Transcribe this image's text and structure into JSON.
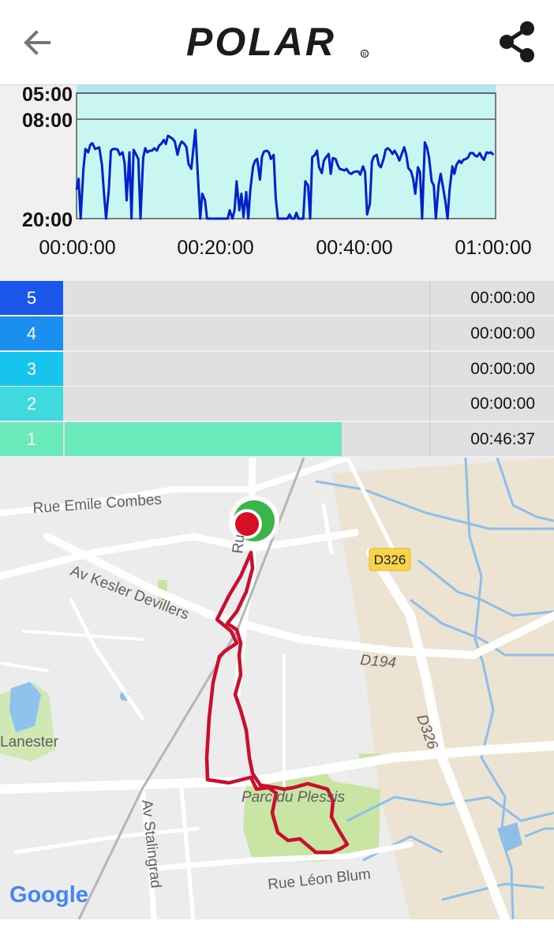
{
  "header": {
    "brand": "POLAR",
    "back_icon": "arrow-left-icon",
    "share_icon": "share-icon"
  },
  "chart_data": {
    "type": "line",
    "xlabel": "",
    "ylabel": "",
    "y_axis_inverted": true,
    "y_tick_labels": [
      "05:00",
      "08:00",
      "20:00"
    ],
    "x_tick_labels": [
      "00:00:00",
      "00:20:00",
      "00:40:00",
      "01:00:00"
    ],
    "x_range_min": [
      0,
      61
    ],
    "y_range_min_per_km": [
      4.5,
      20
    ],
    "line_color": "#0022cc",
    "band_color": "#c9f6f0",
    "series": [
      {
        "x_min": [
          0.0,
          0.3,
          0.6,
          1.0,
          1.3,
          1.7,
          2.0,
          2.3,
          2.7,
          3.0,
          3.3,
          3.7,
          4.0,
          4.3,
          4.7,
          5.0,
          5.3,
          5.7,
          6.0,
          6.3,
          6.7,
          7.0,
          7.3,
          7.7,
          8.0,
          8.3,
          8.7,
          9.0,
          9.3,
          9.7,
          10.0,
          10.3,
          10.7,
          11.0,
          11.3,
          11.7,
          12.0,
          12.3,
          12.7,
          13.0,
          13.3,
          13.7,
          14.0,
          14.3,
          14.7,
          15.0,
          15.3,
          15.7,
          16.0,
          16.3,
          16.7,
          17.0,
          17.3,
          17.7,
          18.0,
          18.3,
          18.7,
          19.0,
          19.3,
          19.7,
          20.0,
          20.3,
          20.7,
          21.0,
          21.3,
          21.7,
          22.0,
          22.3,
          22.7,
          23.0,
          23.3,
          23.7,
          24.0,
          24.3,
          24.7,
          25.0,
          25.3,
          25.7,
          26.0,
          26.3,
          26.7,
          27.0,
          27.3,
          27.7,
          28.0,
          28.3,
          28.7,
          29.0,
          29.3,
          29.7,
          30.0,
          30.3,
          30.7,
          31.0,
          31.3,
          31.7,
          32.0,
          32.3,
          32.7,
          33.0,
          33.3,
          33.7,
          34.0,
          34.3,
          34.7,
          35.0,
          35.3,
          35.7,
          36.0,
          36.3,
          36.7,
          37.0,
          37.3,
          37.7,
          38.0,
          38.3,
          38.7,
          39.0,
          39.3,
          39.7,
          40.0,
          40.3,
          40.7,
          41.0,
          41.3,
          41.7,
          42.0,
          42.3,
          42.7,
          43.0,
          43.3,
          43.7,
          44.0,
          44.3,
          44.7,
          45.0,
          45.3,
          45.7,
          46.0,
          46.3,
          46.7,
          47.0,
          47.3,
          47.7,
          48.0,
          48.3,
          48.7,
          49.0,
          49.3,
          49.7,
          50.0,
          50.3,
          50.7,
          51.0,
          51.3,
          51.7,
          52.0,
          52.3,
          52.7,
          53.0,
          53.3,
          53.7,
          54.0,
          54.3,
          54.7,
          55.0,
          55.3,
          55.7,
          56.0,
          56.3,
          56.7,
          57.0,
          57.3,
          57.7,
          58.0,
          58.3,
          58.7,
          59.0,
          59.3,
          59.7,
          60.0,
          60.3,
          60.7
        ],
        "y_min_per_km": [
          16.5,
          15.2,
          20.0,
          14.0,
          11.6,
          12.0,
          11.1,
          10.9,
          11.6,
          11.5,
          11.4,
          13.5,
          17.0,
          20.0,
          16.5,
          11.8,
          11.6,
          11.6,
          11.7,
          12.3,
          12.0,
          13.3,
          17.8,
          12.0,
          20.0,
          11.7,
          12.3,
          12.8,
          20.0,
          12.7,
          11.5,
          12.0,
          11.8,
          11.8,
          11.5,
          11.8,
          11.2,
          11.0,
          10.5,
          11.0,
          10.0,
          10.2,
          10.4,
          10.7,
          12.3,
          11.2,
          10.7,
          11.0,
          11.4,
          13.4,
          14.0,
          11.6,
          9.3,
          15.5,
          20.0,
          17.0,
          17.8,
          20.0,
          20.0,
          20.0,
          20.0,
          20.0,
          20.0,
          20.0,
          20.0,
          20.0,
          20.0,
          19.0,
          20.0,
          19.0,
          15.5,
          19.0,
          17.0,
          19.8,
          16.8,
          20.0,
          16.5,
          13.7,
          13.0,
          12.8,
          15.3,
          12.5,
          11.9,
          11.8,
          12.0,
          12.8,
          12.3,
          17.5,
          20.0,
          20.0,
          20.0,
          20.0,
          20.0,
          19.5,
          20.0,
          20.0,
          19.3,
          20.0,
          20.0,
          20.0,
          15.5,
          16.0,
          20.0,
          12.6,
          12.3,
          11.8,
          13.8,
          14.5,
          13.0,
          12.6,
          12.2,
          14.6,
          12.7,
          12.8,
          13.5,
          14.0,
          14.1,
          14.2,
          14.0,
          14.5,
          14.6,
          14.4,
          14.3,
          14.3,
          14.7,
          13.7,
          14.4,
          19.5,
          18.2,
          13.1,
          12.5,
          12.3,
          13.5,
          13.8,
          12.8,
          11.7,
          11.5,
          11.8,
          12.2,
          11.8,
          12.4,
          13.0,
          12.3,
          11.4,
          12.3,
          13.9,
          14.3,
          15.2,
          17.0,
          13.8,
          14.4,
          20.0,
          10.8,
          11.4,
          12.6,
          15.5,
          16.0,
          20.0,
          16.0,
          14.6,
          16.0,
          18.0,
          20.0,
          16.5,
          13.7,
          14.6,
          13.5,
          13.0,
          13.3,
          12.9,
          12.8,
          12.6,
          12.1,
          12.1,
          12.4,
          12.5,
          12.1,
          12.6,
          12.9,
          12.0,
          12.1,
          12.0,
          12.3,
          14.1
        ]
      }
    ]
  },
  "zones": [
    {
      "label": "5",
      "time": "00:00:00",
      "fraction": 0.0,
      "color": "#1a56e8"
    },
    {
      "label": "4",
      "time": "00:00:00",
      "fraction": 0.0,
      "color": "#1a8ff0"
    },
    {
      "label": "3",
      "time": "00:00:00",
      "fraction": 0.0,
      "color": "#16c4ee"
    },
    {
      "label": "2",
      "time": "00:00:00",
      "fraction": 0.0,
      "color": "#3fd9de"
    },
    {
      "label": "1",
      "time": "00:46:37",
      "fraction": 0.76,
      "color": "#6ae9ba"
    }
  ],
  "map": {
    "streets": {
      "rue_emile_combes": "Rue Emile Combes",
      "av_kesler_devillers": "Av Kesler Devillers",
      "d326_top": "D326",
      "d194": "D194",
      "d326_side": "D326",
      "lanester": "Lanester",
      "parc_du_plessis": "Parc du Plessis",
      "av_stalingrad": "Av Stalingrad",
      "rue_leon_blum": "Rue Léon Blum",
      "ru_partial": "Ru"
    },
    "route_color": "#c8102e",
    "start_marker_color": "#3bb54a",
    "end_marker_color": "#d50f25",
    "google_logo": "Google"
  }
}
